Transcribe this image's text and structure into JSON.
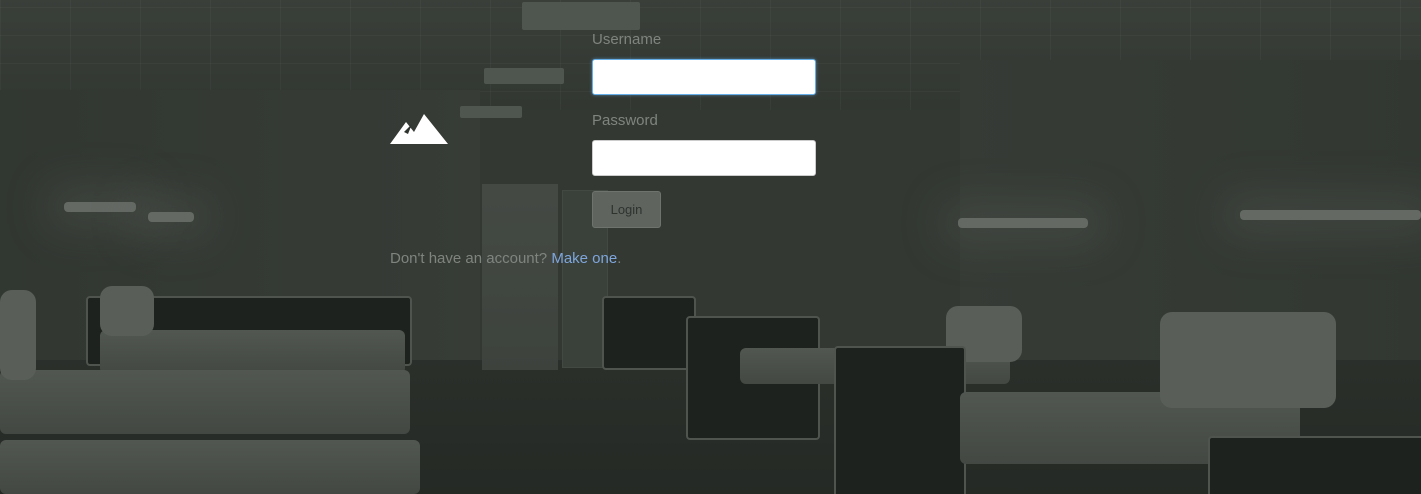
{
  "login_form": {
    "username_label": "Username",
    "username_value": "",
    "password_label": "Password",
    "password_value": "",
    "login_button_label": "Login"
  },
  "signup": {
    "prompt_text": "Don't have an account?",
    "link_text": "Make one",
    "trailing_text": "."
  },
  "logo": {
    "icon": "mountain-logo-icon"
  },
  "colors": {
    "label_text": "#7f847f",
    "link": "#7ea6dc",
    "input_focus_border": "#66afe9",
    "button_bg": "#5f645f"
  }
}
